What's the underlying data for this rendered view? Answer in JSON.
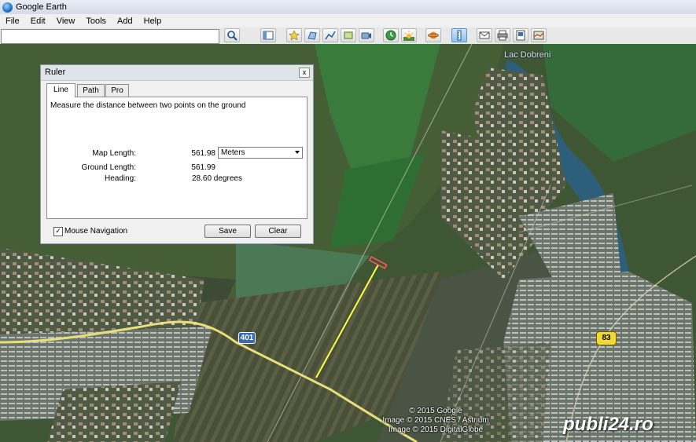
{
  "window": {
    "title": "Google Earth"
  },
  "menu": [
    "File",
    "Edit",
    "View",
    "Tools",
    "Add",
    "Help"
  ],
  "toolbar": {
    "search_value": "",
    "buttons": [
      "search-icon",
      "sidebar-icon",
      "placemark-icon",
      "polygon-icon",
      "path-icon",
      "image-overlay-icon",
      "record-tour-icon",
      "historical-imagery-icon",
      "sunlight-icon",
      "sky-icon",
      "ruler-icon",
      "email-icon",
      "print-icon",
      "save-image-icon",
      "view-in-maps-icon"
    ]
  },
  "map": {
    "lake_label": "Lac Dobreni",
    "road_401": "401",
    "road_83": "83",
    "copyright": [
      "© 2015 Google",
      "Image © 2015 CNES / Astrium",
      "Image © 2015 DigitalGlobe"
    ],
    "watermark": "publi24.ro",
    "colors": {
      "measure_line": "#ffff40",
      "road": "#e8df7a",
      "lake": "#2e5f7a"
    }
  },
  "ruler": {
    "title": "Ruler",
    "close": "x",
    "tabs": [
      "Line",
      "Path",
      "Pro"
    ],
    "active_tab": "Line",
    "description": "Measure the distance between two points on the ground",
    "map_length_label": "Map Length:",
    "map_length_value": "561.98",
    "units_selected": "Meters",
    "ground_length_label": "Ground Length:",
    "ground_length_value": "561.99",
    "heading_label": "Heading:",
    "heading_value": "28.60 degrees",
    "mouse_navigation_label": "Mouse Navigation",
    "mouse_navigation_checked": true,
    "save_label": "Save",
    "clear_label": "Clear"
  }
}
